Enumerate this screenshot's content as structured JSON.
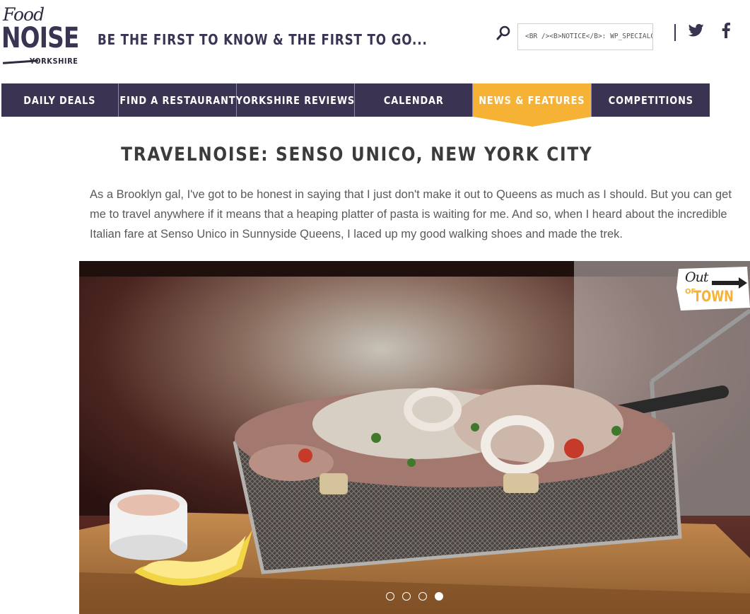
{
  "header": {
    "logo_food": "Food",
    "logo_noise": "NOISE",
    "logo_region": "YORKSHIRE",
    "tagline": "BE THE FIRST TO KNOW & THE FIRST TO GO...",
    "search_value": "<BR /><B>NOTICE</B>:  WP_SPECIALC",
    "icons": [
      "search-icon",
      "twitter-icon",
      "facebook-icon"
    ]
  },
  "nav": {
    "items": [
      {
        "label": "DAILY DEALS",
        "active": false
      },
      {
        "label": "FIND A RESTAURANT",
        "active": false
      },
      {
        "label": "YORKSHIRE REVIEWS",
        "active": false
      },
      {
        "label": "CALENDAR",
        "active": false
      },
      {
        "label": "NEWS & FEATURES",
        "active": true
      },
      {
        "label": "COMPETITIONS",
        "active": false
      }
    ]
  },
  "article": {
    "title": "TRAVELNOISE: SENSO UNICO, NEW YORK CITY",
    "intro": "As a Brooklyn gal, I've got to be honest in saying that I just don't make it out to Queens as much as I should. But you can get me to travel anywhere if it means that a heaping platter of pasta is waiting for me. And so, when I heard about the incredible Italian fare at Senso Unico in Sunnyside Queens, I laced up my good walking shoes and made the trek."
  },
  "hero": {
    "badge_out": "Out",
    "badge_of": "OF",
    "badge_town": "TOWN",
    "slides_total": 4,
    "active_slide": 4
  },
  "colors": {
    "brand_purple": "#3a3452",
    "accent_orange": "#f6b234"
  }
}
